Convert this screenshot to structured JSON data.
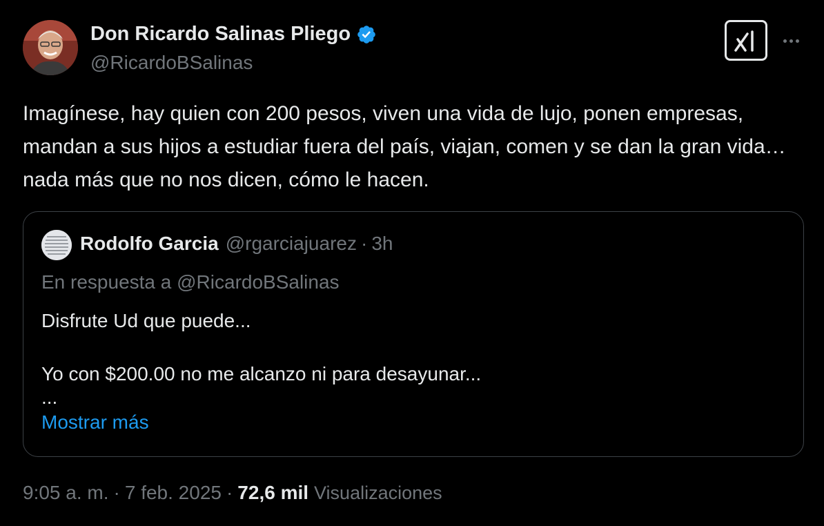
{
  "author": {
    "display_name": "Don Ricardo Salinas Pliego",
    "handle": "@RicardoBSalinas",
    "verified": true,
    "verified_color": "#1d9bf0"
  },
  "icons": {
    "verified": "verified-badge-icon",
    "grok": "grok-icon",
    "more": "more-options-icon"
  },
  "tweet": {
    "text": "Imagínese, hay quien con 200 pesos, viven una vida de lujo, ponen empresas, mandan a sus hijos a estudiar fuera del país, viajan, comen y se dan la gran vida… nada más que no nos dicen, cómo le hacen."
  },
  "quote": {
    "display_name": "Rodolfo Garcia",
    "handle": "@rgarciajuarez",
    "separator": "·",
    "time": "3h",
    "reply_prefix": "En respuesta a",
    "reply_handle": "@RicardoBSalinas",
    "lines": [
      "Disfrute Ud que puede...",
      "Yo con $200.00 no me alcanzo ni para desayunar...",
      "..."
    ],
    "show_more": "Mostrar más"
  },
  "meta": {
    "time": "9:05 a. m.",
    "separator": "·",
    "date": "7 feb. 2025",
    "views_count": "72,6 mil",
    "views_label": "Visualizaciones"
  },
  "colors": {
    "background": "#000000",
    "primary_text": "#e7e9ea",
    "secondary_text": "#71767b",
    "link": "#1d9bf0",
    "border": "#3d4247"
  }
}
